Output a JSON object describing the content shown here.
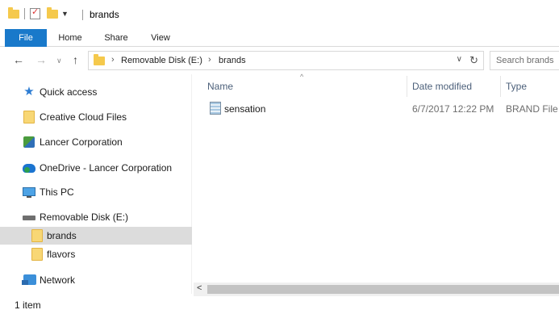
{
  "window": {
    "title": "brands"
  },
  "ribbon": {
    "tabs": [
      "File",
      "Home",
      "Share",
      "View"
    ],
    "active_tab": "File"
  },
  "address": {
    "breadcrumbs": [
      "Removable Disk (E:)",
      "brands"
    ],
    "search_placeholder": "Search brands"
  },
  "nav_pane": {
    "items": [
      {
        "label": "Quick access",
        "icon": "star-icon"
      },
      {
        "label": "Creative Cloud Files",
        "icon": "folder-icon"
      },
      {
        "label": "Lancer Corporation",
        "icon": "corporation-icon"
      },
      {
        "label": "OneDrive - Lancer Corporation",
        "icon": "onedrive-icon"
      },
      {
        "label": "This PC",
        "icon": "computer-icon"
      },
      {
        "label": "Removable Disk (E:)",
        "icon": "disk-icon"
      },
      {
        "label": "brands",
        "icon": "folder-icon",
        "selected": true
      },
      {
        "label": "flavors",
        "icon": "folder-icon"
      },
      {
        "label": "Network",
        "icon": "network-icon"
      }
    ]
  },
  "file_list": {
    "columns": [
      "Name",
      "Date modified",
      "Type"
    ],
    "rows": [
      {
        "name": "sensation",
        "date_modified": "6/7/2017 12:22 PM",
        "type": "BRAND File"
      }
    ]
  },
  "status_bar": {
    "item_count": "1 item"
  },
  "colors": {
    "accent": "#1979ca",
    "selected_bg": "#dcdcdc",
    "folder": "#f5c94c"
  }
}
